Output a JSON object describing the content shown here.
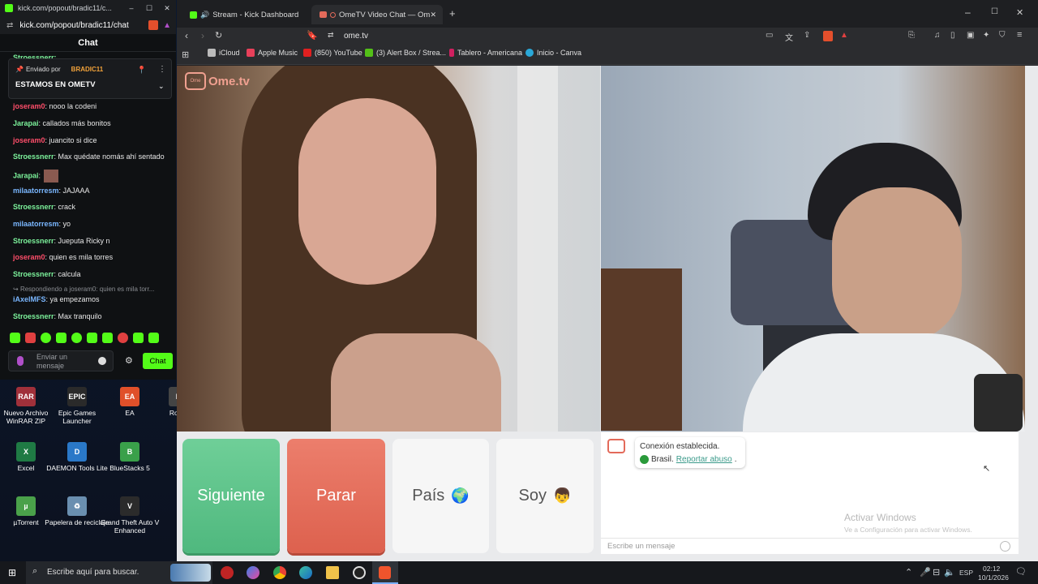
{
  "kick_window": {
    "title": "kick.com/popout/bradic11/c...",
    "url": "kick.com/popout/bradic11/chat",
    "header": "Chat",
    "pinned": {
      "sent_by_label": "Enviado por",
      "user": "BRADIC11",
      "text": "ESTAMOS EN OMETV"
    },
    "partial_user": "Stroessnerr:",
    "messages": [
      {
        "user": "joseram0",
        "text": ": nooo la codeni",
        "color": "#ff4e6a"
      },
      {
        "user": "Jarapai",
        "text": ": callados más bonitos",
        "color": "#7cf29b"
      },
      {
        "user": "joseram0",
        "text": ": juancito si dice",
        "color": "#ff4e6a"
      },
      {
        "user": "Stroessnerr",
        "text": ": Max quédate nomás ahí sentado",
        "color": "#7cf29b"
      },
      {
        "user": "Jarapai",
        "text": ":",
        "color": "#7cf29b"
      },
      {
        "user": "milaatorresm",
        "text": ": JAJAAA",
        "color": "#7ab7ff"
      },
      {
        "user": "Stroessnerr",
        "text": ": crack",
        "color": "#7cf29b"
      },
      {
        "user": "milaatorresm",
        "text": ": yo",
        "color": "#7ab7ff"
      },
      {
        "user": "Stroessnerr",
        "text": ": Jueputa Ricky n",
        "color": "#7cf29b"
      },
      {
        "user": "joseram0",
        "text": ": quien es mila torres",
        "color": "#ff4e6a"
      },
      {
        "user": "Stroessnerr",
        "text": ": calcula",
        "color": "#7cf29b"
      }
    ],
    "reply_hint": "Respondiendo a joseram0: quien es mila torr...",
    "messages2": [
      {
        "user": "iAxelMFS",
        "text": ": ya empezamos",
        "color": "#7ab7ff"
      },
      {
        "user": "Stroessnerr",
        "text": ": Max tranquilo",
        "color": "#7cf29b"
      }
    ],
    "input_placeholder": "Enviar un mensaje",
    "send_label": "Chat"
  },
  "desktop_icons": [
    {
      "label": "Nuevo Archivo WinRAR ZIP",
      "color": "#a0303a",
      "glyph": "RAR"
    },
    {
      "label": "Epic Games Launcher",
      "color": "#2a2a2a",
      "glyph": "EPIC"
    },
    {
      "label": "EA",
      "color": "#e0502a",
      "glyph": "EA"
    },
    {
      "label": "Roblo",
      "color": "#444",
      "glyph": "R"
    },
    {
      "label": "Excel",
      "color": "#1f7a44",
      "glyph": "X"
    },
    {
      "label": "DAEMON Tools Lite",
      "color": "#2a78c8",
      "glyph": "D"
    },
    {
      "label": "BlueStacks 5",
      "color": "#3aa04a",
      "glyph": "B"
    },
    {
      "label": "µTorrent",
      "color": "#4aa14a",
      "glyph": "µ"
    },
    {
      "label": "Papelera de reciclaje",
      "color": "#6a8fb0",
      "glyph": "♻"
    },
    {
      "label": "Grand Theft Auto V Enhanced",
      "color": "#2b2b2b",
      "glyph": "V"
    }
  ],
  "browser": {
    "tabs": [
      {
        "label": "Stream - Kick Dashboard"
      },
      {
        "label": "OmeTV Video Chat — Omeg"
      }
    ],
    "url": "ome.tv",
    "bookmarks": [
      "iCloud",
      "Apple Music",
      "(850) YouTube",
      "(3) Alert Box / Strea...",
      "Tablero - Americana",
      "Inicio - Canva"
    ]
  },
  "ometv": {
    "logo": "Ome.tv",
    "buttons": {
      "next": "Siguiente",
      "stop": "Parar",
      "country": "País",
      "country_icon": "🌍",
      "gender": "Soy",
      "gender_icon": "👦"
    },
    "status_text": "Conexión establecida.",
    "country_text": "Brasil.",
    "report_link": "Reportar abuso",
    "watermark_title": "Activar Windows",
    "watermark_sub": "Ve a Configuración para activar Windows.",
    "message_placeholder": "Escribe un mensaje"
  },
  "taskbar": {
    "search_placeholder": "Escribe aquí para buscar.",
    "lang": "ESP",
    "time": "02:12",
    "date": "10/1/2026"
  }
}
